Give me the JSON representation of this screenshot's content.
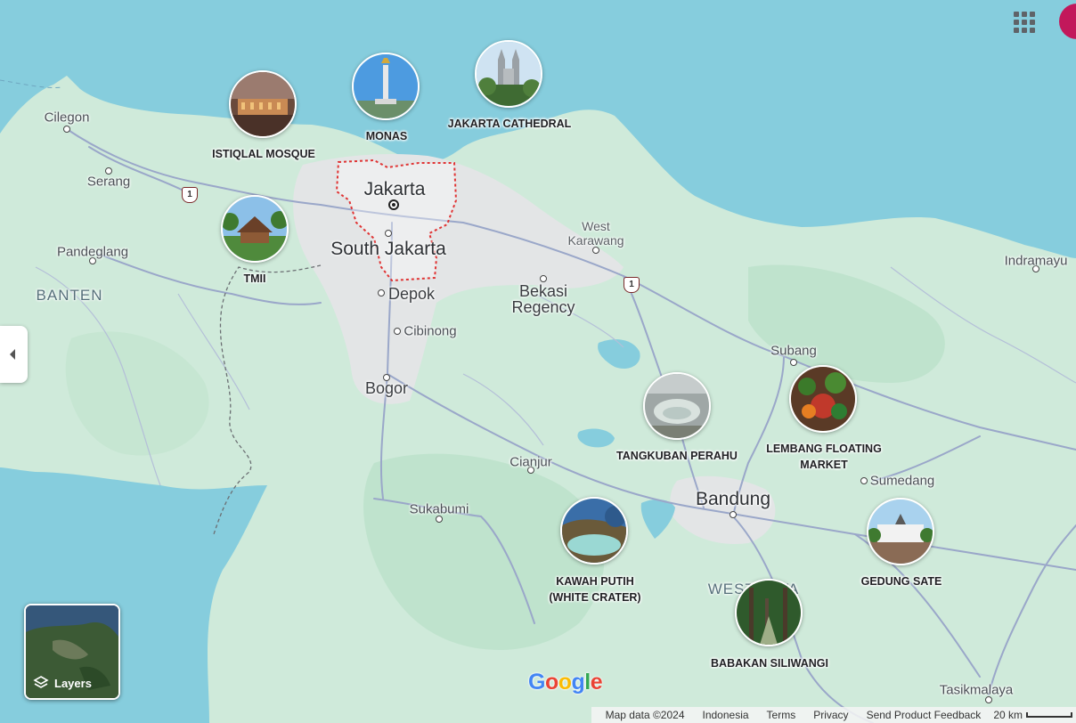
{
  "map": {
    "colors": {
      "water": "#86cddd",
      "land": "#cfeada",
      "urban": "#e3e5e6",
      "road": "#9aa7c9",
      "boundary": "#e03434"
    },
    "places": [
      {
        "id": "cilegon",
        "label": "Cilegon"
      },
      {
        "id": "serang",
        "label": "Serang"
      },
      {
        "id": "pandeglang",
        "label": "Pandeglang"
      },
      {
        "id": "banten",
        "label": "BANTEN"
      },
      {
        "id": "jakarta",
        "label": "Jakarta"
      },
      {
        "id": "south-jakarta",
        "label": "South Jakarta"
      },
      {
        "id": "depok",
        "label": "Depok"
      },
      {
        "id": "cibinong",
        "label": "Cibinong"
      },
      {
        "id": "bogor",
        "label": "Bogor"
      },
      {
        "id": "bekasi",
        "label": "Bekasi Regency"
      },
      {
        "id": "karawang",
        "label": "West Karawang"
      },
      {
        "id": "indramayu",
        "label": "Indramayu"
      },
      {
        "id": "subang",
        "label": "Subang"
      },
      {
        "id": "cianjur",
        "label": "Cianjur"
      },
      {
        "id": "sukabumi",
        "label": "Sukabumi"
      },
      {
        "id": "bandung",
        "label": "Bandung"
      },
      {
        "id": "sumedang",
        "label": "Sumedang"
      },
      {
        "id": "west-java",
        "label": "WEST JAVA"
      },
      {
        "id": "tasikmalaya",
        "label": "Tasikmalaya"
      }
    ],
    "route_shields": [
      "1",
      "1"
    ],
    "pois": [
      {
        "id": "istiqlal",
        "label": "ISTIQLAL MOSQUE"
      },
      {
        "id": "monas",
        "label": "MONAS"
      },
      {
        "id": "cathedral",
        "label": "JAKARTA CATHEDRAL"
      },
      {
        "id": "tmii",
        "label": "TMII"
      },
      {
        "id": "tangkuban",
        "label": "TANGKUBAN PERAHU"
      },
      {
        "id": "lembang",
        "label": "LEMBANG FLOATING MARKET"
      },
      {
        "id": "kawah",
        "label": "KAWAH PUTIH (WHITE CRATER)"
      },
      {
        "id": "gedung",
        "label": "GEDUNG SATE"
      },
      {
        "id": "babakan",
        "label": "BABAKAN SILIWANGI"
      }
    ]
  },
  "controls": {
    "layers_label": "Layers",
    "apps_icon": "apps-grid-icon",
    "collapse_icon": "chevron-left-icon"
  },
  "footer": {
    "logo": "Google",
    "map_data": "Map data ©2024",
    "country": "Indonesia",
    "terms": "Terms",
    "privacy": "Privacy",
    "feedback": "Send Product Feedback",
    "scale": "20 km"
  }
}
